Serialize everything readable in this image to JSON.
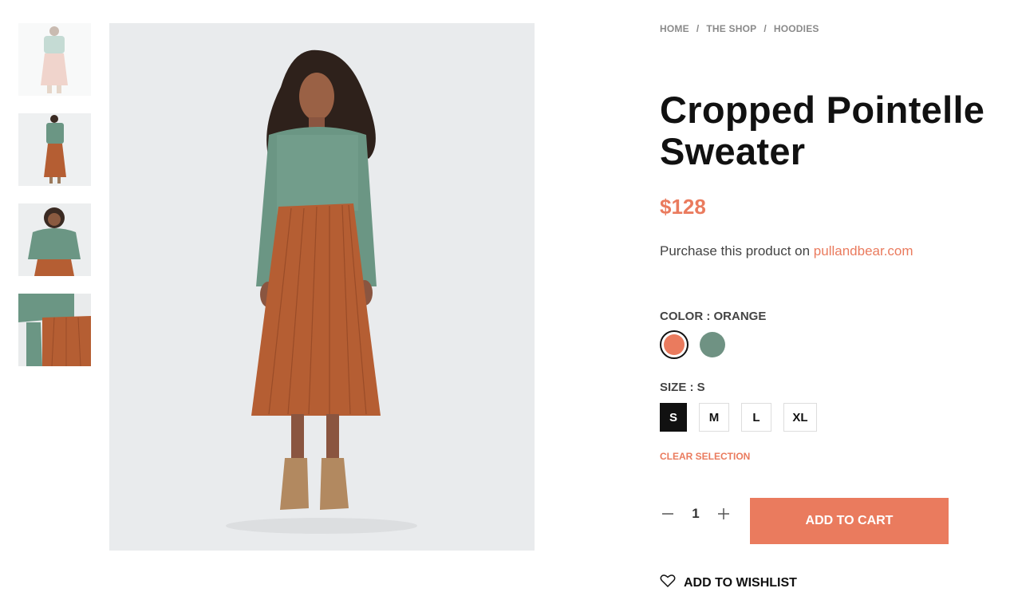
{
  "gallery": {
    "thumbnails": [
      {
        "name": "thumbnail-1",
        "alt": "full look faded"
      },
      {
        "name": "thumbnail-2",
        "alt": "full look"
      },
      {
        "name": "thumbnail-3",
        "alt": "upper body"
      },
      {
        "name": "thumbnail-4",
        "alt": "sleeve detail"
      }
    ],
    "main_image": "model-full-length-photo"
  },
  "breadcrumb": {
    "home": "HOME",
    "shop": "THE SHOP",
    "category": "HOODIES",
    "separator": "/"
  },
  "product": {
    "title": "Cropped Pointelle Sweater",
    "price": "$128",
    "purchase_text": "Purchase this product on",
    "purchase_link": "pullandbear.com"
  },
  "color": {
    "label": "COLOR : ORANGE",
    "options": [
      {
        "name": "orange",
        "hex": "#ea7b5e",
        "selected": true
      },
      {
        "name": "green",
        "hex": "#6f9283",
        "selected": false
      }
    ]
  },
  "size": {
    "label": "SIZE : S",
    "options": [
      "S",
      "M",
      "L",
      "XL"
    ],
    "selected": "S"
  },
  "clear_selection": "CLEAR SELECTION",
  "quantity": {
    "value": "1",
    "minus_icon": "minus-icon",
    "plus_icon": "plus-icon"
  },
  "add_to_cart": "ADD TO CART",
  "wishlist": {
    "label": "ADD TO WISHLIST",
    "icon": "heart-icon"
  },
  "colors": {
    "accent": "#ea7b5e",
    "dark": "#111111",
    "image_bg": "#e9ebed"
  }
}
